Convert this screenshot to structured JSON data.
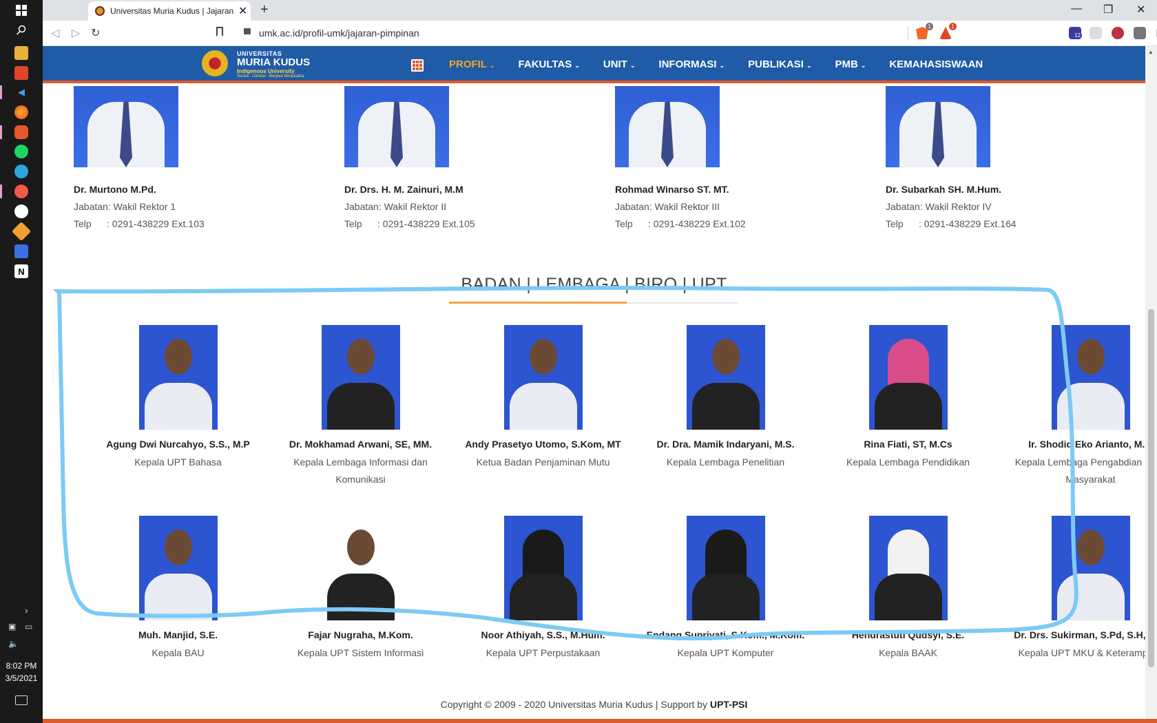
{
  "taskbar": {
    "time": "8:02 PM",
    "date": "3/5/2021"
  },
  "browser": {
    "tab_title": "Universitas Muria Kudus | Jajaran",
    "url": "umk.ac.id/profil-umk/jajaran-pimpinan",
    "badges": {
      "brave": "1",
      "rewards": "1",
      "ext": "12"
    }
  },
  "site": {
    "logo": {
      "line1": "UNIVERSITAS",
      "line2": "MURIA KUDUS",
      "line3": "Indigenous University",
      "line4": "Sosba - Cerdas - Berjiwa Wirausaha"
    },
    "nav": [
      {
        "label": "PROFIL",
        "caret": "⌄"
      },
      {
        "label": "FAKULTAS",
        "caret": "⌄"
      },
      {
        "label": "UNIT",
        "caret": "⌄"
      },
      {
        "label": "INFORMASI",
        "caret": "⌄"
      },
      {
        "label": "PUBLIKASI",
        "caret": "⌄"
      },
      {
        "label": "PMB",
        "caret": "⌄"
      },
      {
        "label": "KEMAHASISWAAN",
        "caret": ""
      }
    ],
    "accent_color": "#f6a623",
    "header_color": "#1f5ba6"
  },
  "rektors": [
    {
      "name": "Dr. Murtono M.Pd.",
      "jabatan": "Jabatan: Wakil Rektor 1",
      "telp_label": "Telp",
      "telp": ": 0291-438229 Ext.103"
    },
    {
      "name": "Dr. Drs. H. M. Zainuri, M.M",
      "jabatan": "Jabatan: Wakil Rektor II",
      "telp_label": "Telp",
      "telp": ": 0291-438229 Ext.105"
    },
    {
      "name": "Rohmad Winarso ST. MT.",
      "jabatan": "Jabatan: Wakil Rektor III",
      "telp_label": "Telp",
      "telp": ": 0291-438229 Ext.102"
    },
    {
      "name": "Dr. Subarkah SH. M.Hum.",
      "jabatan": "Jabatan: Wakil Rektor IV",
      "telp_label": "Telp",
      "telp": ": 0291-438229 Ext.164"
    }
  ],
  "section_title": "BADAN | LEMBAGA | BIRO | UPT",
  "members": [
    {
      "name": "Agung Dwi Nurcahyo, S.S., M.P",
      "role": "Kepala UPT Bahasa"
    },
    {
      "name": "Dr. Mokhamad Arwani, SE, MM.",
      "role": "Kepala Lembaga Informasi dan Komunikasi"
    },
    {
      "name": "Andy Prasetyo Utomo, S.Kom, MT",
      "role": "Ketua Badan Penjaminan Mutu"
    },
    {
      "name": "Dr. Dra. Mamik Indaryani, M.S.",
      "role": "Kepala Lembaga Penelitian"
    },
    {
      "name": "Rina Fiati, ST, M.Cs",
      "role": "Kepala Lembaga Pendidikan"
    },
    {
      "name": "Ir. Shodiq Eko Arianto, M.P.",
      "role": "Kepala Lembaga Pengabdian pada Masyarakat"
    },
    {
      "name": "Muh. Manjid, S.E.",
      "role": "Kepala BAU"
    },
    {
      "name": "Fajar Nugraha, M.Kom.",
      "role": "Kepala UPT Sistem Informasi"
    },
    {
      "name": "Noor Athiyah, S.S., M.Hum.",
      "role": "Kepala UPT Perpustakaan"
    },
    {
      "name": "Endang Supriyati, S.Kom., M.Kom.",
      "role": "Kepala UPT Komputer"
    },
    {
      "name": "Hendrastuti Qudsyi, S.E.",
      "role": "Kepala BAAK"
    },
    {
      "name": "Dr. Drs. Sukirman, S.Pd, S.H, M.M",
      "role": "Kepala UPT MKU & Keterampilan"
    }
  ],
  "footer": {
    "copyright": "Copyright © 2009 - 2020 Universitas Muria Kudus | Support by ",
    "support": "UPT-PSI"
  }
}
